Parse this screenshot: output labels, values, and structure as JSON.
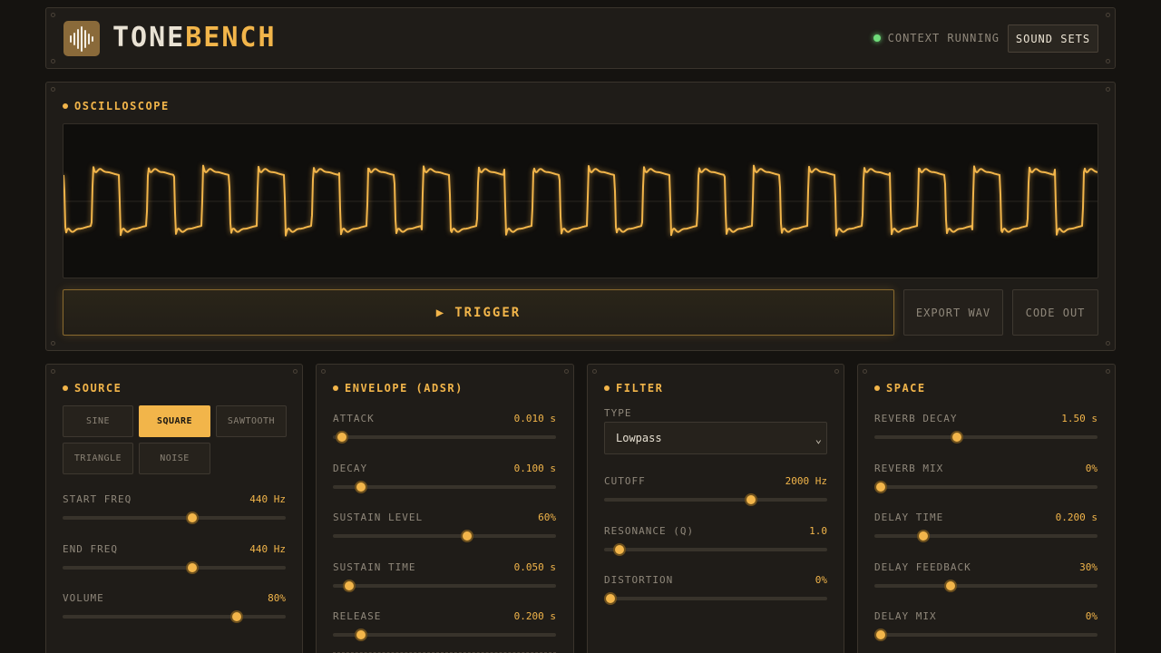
{
  "header": {
    "brand_a": "TONE",
    "brand_b": "BENCH",
    "status_text": "CONTEXT RUNNING",
    "sound_sets_label": "SOUND SETS",
    "logo_icon": "waveform-icon"
  },
  "oscilloscope": {
    "title": "OSCILLOSCOPE",
    "trigger_label": "TRIGGER",
    "export_label": "EXPORT WAV",
    "code_label": "CODE OUT"
  },
  "source": {
    "title": "SOURCE",
    "waveforms": [
      "SINE",
      "SQUARE",
      "SAWTOOTH",
      "TRIANGLE",
      "NOISE"
    ],
    "selected_waveform": "SQUARE",
    "controls": [
      {
        "label": "START FREQ",
        "value": "440 Hz",
        "fraction": 0.58
      },
      {
        "label": "END FREQ",
        "value": "440 Hz",
        "fraction": 0.58
      },
      {
        "label": "VOLUME",
        "value": "80%",
        "fraction": 0.78
      }
    ]
  },
  "envelope": {
    "title": "ENVELOPE (ADSR)",
    "controls": [
      {
        "label": "ATTACK",
        "value": "0.010 s",
        "fraction": 0.04
      },
      {
        "label": "DECAY",
        "value": "0.100 s",
        "fraction": 0.125
      },
      {
        "label": "SUSTAIN LEVEL",
        "value": "60%",
        "fraction": 0.6
      },
      {
        "label": "SUSTAIN TIME",
        "value": "0.050 s",
        "fraction": 0.075
      },
      {
        "label": "RELEASE",
        "value": "0.200 s",
        "fraction": 0.125
      }
    ]
  },
  "filter": {
    "title": "FILTER",
    "type_label": "TYPE",
    "type_value": "Lowpass",
    "controls": [
      {
        "label": "CUTOFF",
        "value": "2000 Hz",
        "fraction": 0.66
      },
      {
        "label": "RESONANCE (Q)",
        "value": "1.0",
        "fraction": 0.07
      },
      {
        "label": "DISTORTION",
        "value": "0%",
        "fraction": 0.03
      }
    ]
  },
  "space": {
    "title": "SPACE",
    "controls": [
      {
        "label": "REVERB DECAY",
        "value": "1.50 s",
        "fraction": 0.37
      },
      {
        "label": "REVERB MIX",
        "value": "0%",
        "fraction": 0.03
      },
      {
        "label": "DELAY TIME",
        "value": "0.200 s",
        "fraction": 0.22
      },
      {
        "label": "DELAY FEEDBACK",
        "value": "30%",
        "fraction": 0.34
      },
      {
        "label": "DELAY MIX",
        "value": "0%",
        "fraction": 0.03
      }
    ]
  },
  "colors": {
    "accent": "#f2b54a",
    "status_ok": "#6fdc7a"
  }
}
